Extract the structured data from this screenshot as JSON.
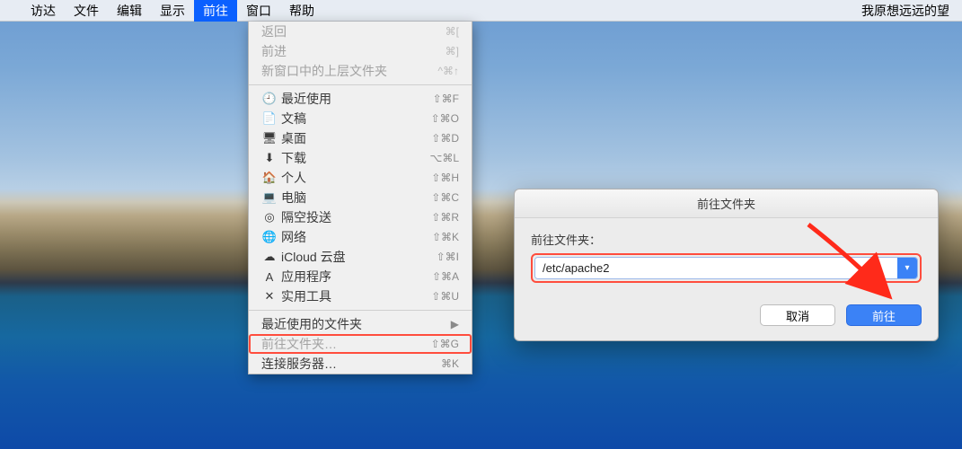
{
  "menubar": {
    "apple": "",
    "items": [
      "访达",
      "文件",
      "编辑",
      "显示",
      "前往",
      "窗口",
      "帮助"
    ],
    "active_index": 4,
    "right_text": "我原想远远的望"
  },
  "dropdown": {
    "section1": [
      {
        "label": "返回",
        "shortcut": "⌘[",
        "disabled": true
      },
      {
        "label": "前进",
        "shortcut": "⌘]",
        "disabled": true
      },
      {
        "label": "新窗口中的上层文件夹",
        "shortcut": "^⌘↑",
        "disabled": true
      }
    ],
    "section2": [
      {
        "icon": "🕘",
        "label": "最近使用",
        "shortcut": "⇧⌘F"
      },
      {
        "icon": "📄",
        "label": "文稿",
        "shortcut": "⇧⌘O"
      },
      {
        "icon": "🖥",
        "label": "桌面",
        "shortcut": "⇧⌘D"
      },
      {
        "icon": "⬇",
        "label": "下载",
        "shortcut": "⌥⌘L"
      },
      {
        "icon": "🏠",
        "label": "个人",
        "shortcut": "⇧⌘H"
      },
      {
        "icon": "💻",
        "label": "电脑",
        "shortcut": "⇧⌘C"
      },
      {
        "icon": "◎",
        "label": "隔空投送",
        "shortcut": "⇧⌘R"
      },
      {
        "icon": "🌐",
        "label": "网络",
        "shortcut": "⇧⌘K"
      },
      {
        "icon": "☁",
        "label": "iCloud 云盘",
        "shortcut": "⇧⌘I"
      },
      {
        "icon": "A",
        "label": "应用程序",
        "shortcut": "⇧⌘A"
      },
      {
        "icon": "✕",
        "label": "实用工具",
        "shortcut": "⇧⌘U"
      }
    ],
    "section3": [
      {
        "label": "最近使用的文件夹",
        "shortcut": "▶"
      },
      {
        "label": "前往文件夹…",
        "shortcut": "⇧⌘G",
        "highlight": true
      },
      {
        "label": "连接服务器…",
        "shortcut": "⌘K"
      }
    ]
  },
  "dialog": {
    "title": "前往文件夹",
    "label": "前往文件夹：",
    "input_value": "/etc/apache2",
    "cancel": "取消",
    "go": "前往"
  },
  "watermark": ""
}
